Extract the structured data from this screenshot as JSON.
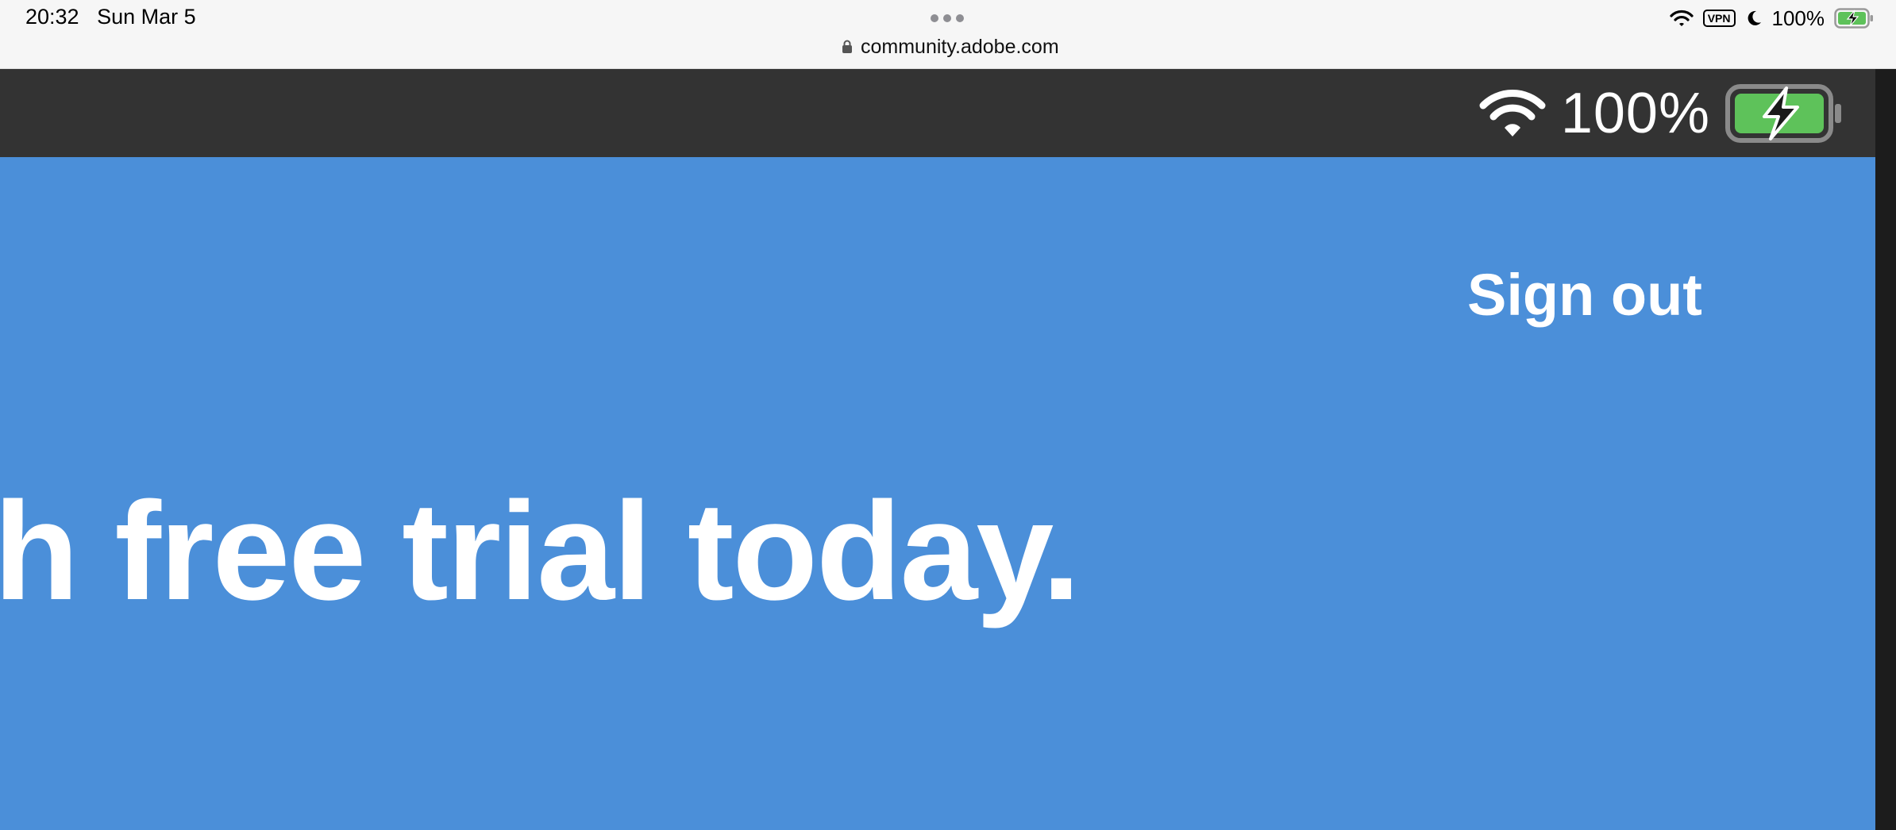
{
  "status_bar": {
    "time": "20:32",
    "date": "Sun Mar 5",
    "vpn_label": "VPN",
    "battery_percent": "100%",
    "icons": [
      "wifi-icon",
      "vpn-icon",
      "moon-icon",
      "battery-charging-icon"
    ]
  },
  "browser": {
    "url": "community.adobe.com",
    "icons": [
      "more-dots-icon",
      "lock-icon"
    ]
  },
  "page_header": {
    "battery_percent": "100%",
    "icons": [
      "wifi-icon",
      "battery-charging-icon"
    ]
  },
  "hero": {
    "sign_out_label": "Sign out",
    "headline": "h free trial today."
  },
  "colors": {
    "hero_blue": "#4b8fd9",
    "header_dark": "#333333",
    "battery_green": "#5ec25a"
  }
}
